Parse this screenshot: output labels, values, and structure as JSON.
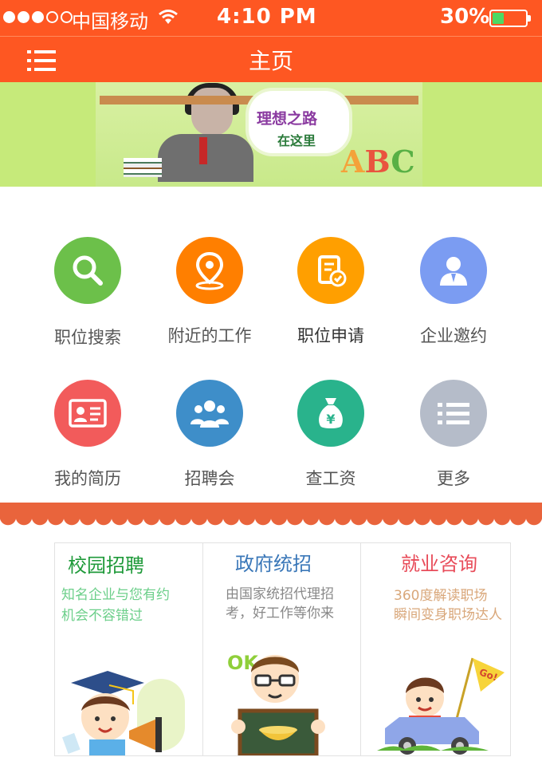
{
  "status_bar": {
    "carrier": "中国移动",
    "time": "4:10 PM",
    "battery": "30%",
    "battery_level": 0.3
  },
  "nav": {
    "title": "主页",
    "menu_icon": "menu-icon"
  },
  "banner": {
    "text_line1": "理想之路",
    "text_line2": "在这里",
    "abc": "ABC"
  },
  "grid": [
    {
      "label": "职位搜索",
      "icon": "search-icon",
      "color": "#6cc04a"
    },
    {
      "label": "附近的工作",
      "icon": "location-icon",
      "color": "#ff7f00"
    },
    {
      "label": "职位申请",
      "icon": "application-icon",
      "color": "#ff9f00"
    },
    {
      "label": "企业邀约",
      "icon": "person-icon",
      "color": "#7b9cf2"
    },
    {
      "label": "我的简历",
      "icon": "resume-icon",
      "color": "#f25b5b"
    },
    {
      "label": "招聘会",
      "icon": "group-icon",
      "color": "#3e8ec9"
    },
    {
      "label": "查工资",
      "icon": "money-bag-icon",
      "color": "#29b38c"
    },
    {
      "label": "更多",
      "icon": "more-list-icon",
      "color": "#b5bcc9"
    }
  ],
  "cards": [
    {
      "title": "校园招聘",
      "desc_line1": "知名企业与您有约",
      "desc_line2": "机会不容错过",
      "title_color": "#1f9a3a",
      "desc_color": "#6ccf8a"
    },
    {
      "title": "政府统招",
      "desc_line1": "由国家统招代理招",
      "desc_line2": "考，好工作等你来",
      "title_color": "#3a77b8",
      "desc_color": "#888888"
    },
    {
      "title": "就业咨询",
      "desc_line1": "360度解读职场",
      "desc_line2": "瞬间变身职场达人",
      "title_color": "#e84c5a",
      "desc_color": "#d9a77a"
    }
  ],
  "card_illustrations": {
    "ok_badge": "OK",
    "flag_text": "Go!"
  }
}
